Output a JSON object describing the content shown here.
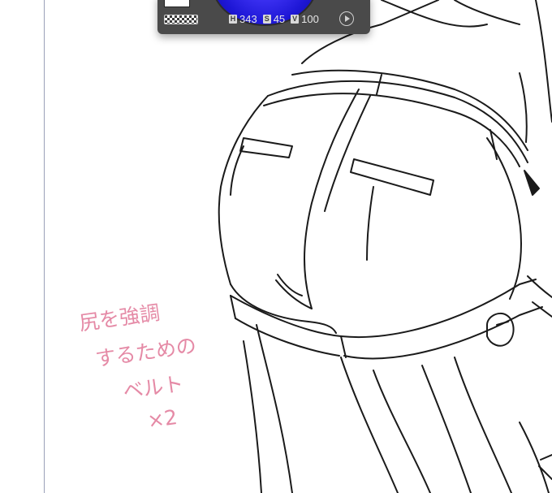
{
  "color_panel": {
    "hue_label": "H",
    "hue_value": "343",
    "saturation_label": "S",
    "saturation_value": "45",
    "value_label": "V",
    "value_value": "100",
    "wheel_color": "#2f26e6"
  },
  "annotation": {
    "lines": [
      "尻を強調",
      "するための",
      "ベルト",
      "×2"
    ],
    "color": "#e58aa6"
  }
}
